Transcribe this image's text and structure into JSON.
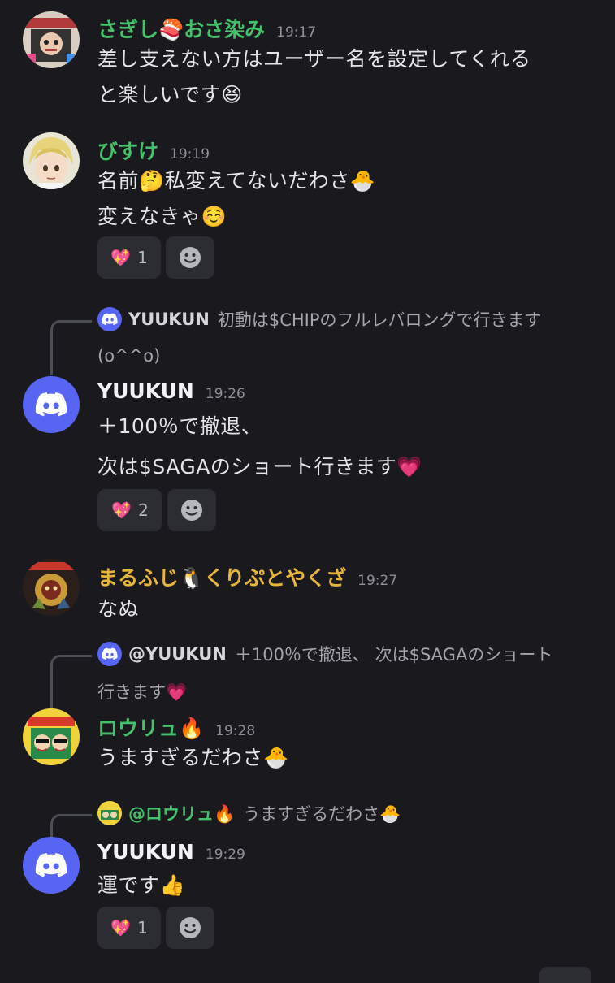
{
  "messages": [
    {
      "author": "さぎし🍣おさ染み",
      "time": "19:17",
      "lines": [
        "差し支えない方はユーザー名を設定してくれる",
        "と楽しいです😆"
      ]
    },
    {
      "author": "びすけ",
      "time": "19:19",
      "lines": [
        "名前🤔私変えてないだわさ🐣",
        "変えなきゃ☺️"
      ],
      "reaction": {
        "emoji": "💖",
        "count": "1"
      }
    },
    {
      "reply": {
        "name": "YUUKUN",
        "text": "初動は$CHIPのフルレバロングで行きます",
        "text2": "(o^^o)"
      },
      "author": "YUUKUN",
      "time": "19:26",
      "lines": [
        "＋100％で撤退、",
        "次は$SAGAのショート行きます💗"
      ],
      "reaction": {
        "emoji": "💖",
        "count": "2"
      }
    },
    {
      "author": "まるふじ🐧くりぷとやくざ",
      "time": "19:27",
      "lines": [
        "なぬ"
      ]
    },
    {
      "reply": {
        "name": "@YUUKUN",
        "text": "＋100％で撤退、 次は$SAGAのショート",
        "text2": "行きます💗"
      },
      "author": "ロウリュ🔥",
      "time": "19:28",
      "lines": [
        "うますぎるだわさ🐣"
      ]
    },
    {
      "reply": {
        "name": "@ロウリュ🔥",
        "text": "うますぎるだわさ🐣"
      },
      "author": "YUUKUN",
      "time": "19:29",
      "lines": [
        "運です👍"
      ],
      "reaction": {
        "emoji": "💖",
        "count": "1"
      }
    }
  ],
  "colors": {
    "background": "#1a1a1e",
    "username_green": "#44c26b",
    "username_yellow": "#e6b53c",
    "discord_blurple": "#5865f2",
    "reaction_bg": "#2c2d33"
  },
  "icons": [
    "discord-logo-icon",
    "add-reaction-icon",
    "reply-connector"
  ]
}
